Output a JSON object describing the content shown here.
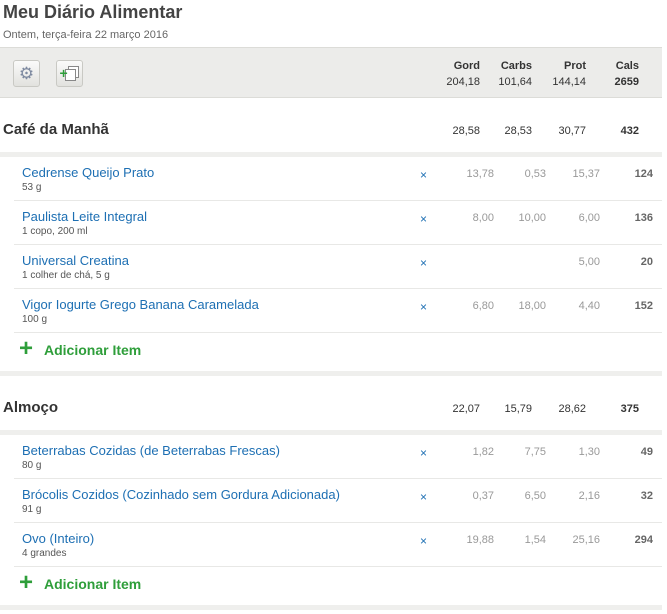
{
  "page": {
    "title": "Meu Diário Alimentar",
    "subtitle": "Ontem, terça-feira 22 março 2016"
  },
  "toolbar": {
    "icons": [
      "gear-icon",
      "copy-add-icon"
    ],
    "headers": {
      "fat": "Gord",
      "carbs": "Carbs",
      "prot": "Prot",
      "cals": "Cals"
    },
    "totals": {
      "fat": "204,18",
      "carbs": "101,64",
      "prot": "144,14",
      "cals": "2659"
    }
  },
  "meals": [
    {
      "name": "Café da Manhã",
      "fat": "28,58",
      "carbs": "28,53",
      "prot": "30,77",
      "cals": "432",
      "add_label": "Adicionar Item",
      "items": [
        {
          "name": "Cedrense Queijo Prato",
          "qty": "53 g",
          "fat": "13,78",
          "carbs": "0,53",
          "prot": "15,37",
          "cals": "124"
        },
        {
          "name": "Paulista Leite Integral",
          "qty": "1 copo, 200 ml",
          "fat": "8,00",
          "carbs": "10,00",
          "prot": "6,00",
          "cals": "136"
        },
        {
          "name": "Universal Creatina",
          "qty": "1 colher de chá, 5 g",
          "fat": "",
          "carbs": "",
          "prot": "5,00",
          "cals": "20"
        },
        {
          "name": "Vigor Iogurte Grego Banana Caramelada",
          "qty": "100 g",
          "fat": "6,80",
          "carbs": "18,00",
          "prot": "4,40",
          "cals": "152"
        }
      ]
    },
    {
      "name": "Almoço",
      "fat": "22,07",
      "carbs": "15,79",
      "prot": "28,62",
      "cals": "375",
      "add_label": "Adicionar Item",
      "items": [
        {
          "name": "Beterrabas Cozidas (de Beterrabas Frescas)",
          "qty": "80 g",
          "fat": "1,82",
          "carbs": "7,75",
          "prot": "1,30",
          "cals": "49"
        },
        {
          "name": "Brócolis Cozidos (Cozinhado sem Gordura Adicionada)",
          "qty": "91 g",
          "fat": "0,37",
          "carbs": "6,50",
          "prot": "2,16",
          "cals": "32"
        },
        {
          "name": "Ovo (Inteiro)",
          "qty": "4 grandes",
          "fat": "19,88",
          "carbs": "1,54",
          "prot": "25,16",
          "cals": "294"
        }
      ]
    }
  ],
  "delete_glyph": "×",
  "add_glyph": "+"
}
